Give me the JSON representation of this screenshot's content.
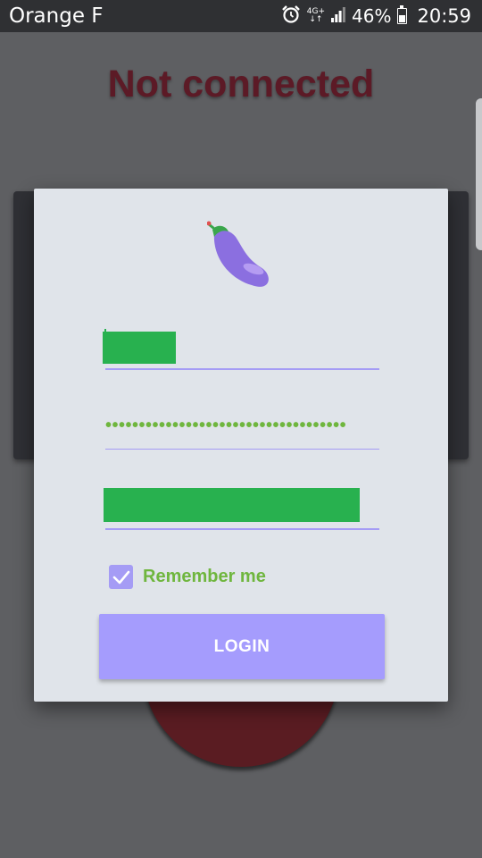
{
  "status_bar": {
    "carrier": "Orange F",
    "network_type_top": "4G+",
    "network_type_bottom": "↓↑",
    "battery_percent": "46%",
    "time": "20:59",
    "icons": [
      "alarm-icon",
      "signal-icon",
      "battery-icon"
    ]
  },
  "background_app": {
    "connection_status": "Not connected",
    "status_color": "#5c1a26"
  },
  "login_dialog": {
    "logo_icon": "eggplant-icon",
    "username_value_redacted": true,
    "password_mask": "••••••••••••••••••••••••••••••••••••",
    "server_value_redacted": true,
    "remember_me": {
      "label": "Remember me",
      "checked": true
    },
    "login_button": {
      "label": "LOGIN"
    },
    "accent_color": "#a59cf5",
    "label_color": "#6fb63e"
  }
}
